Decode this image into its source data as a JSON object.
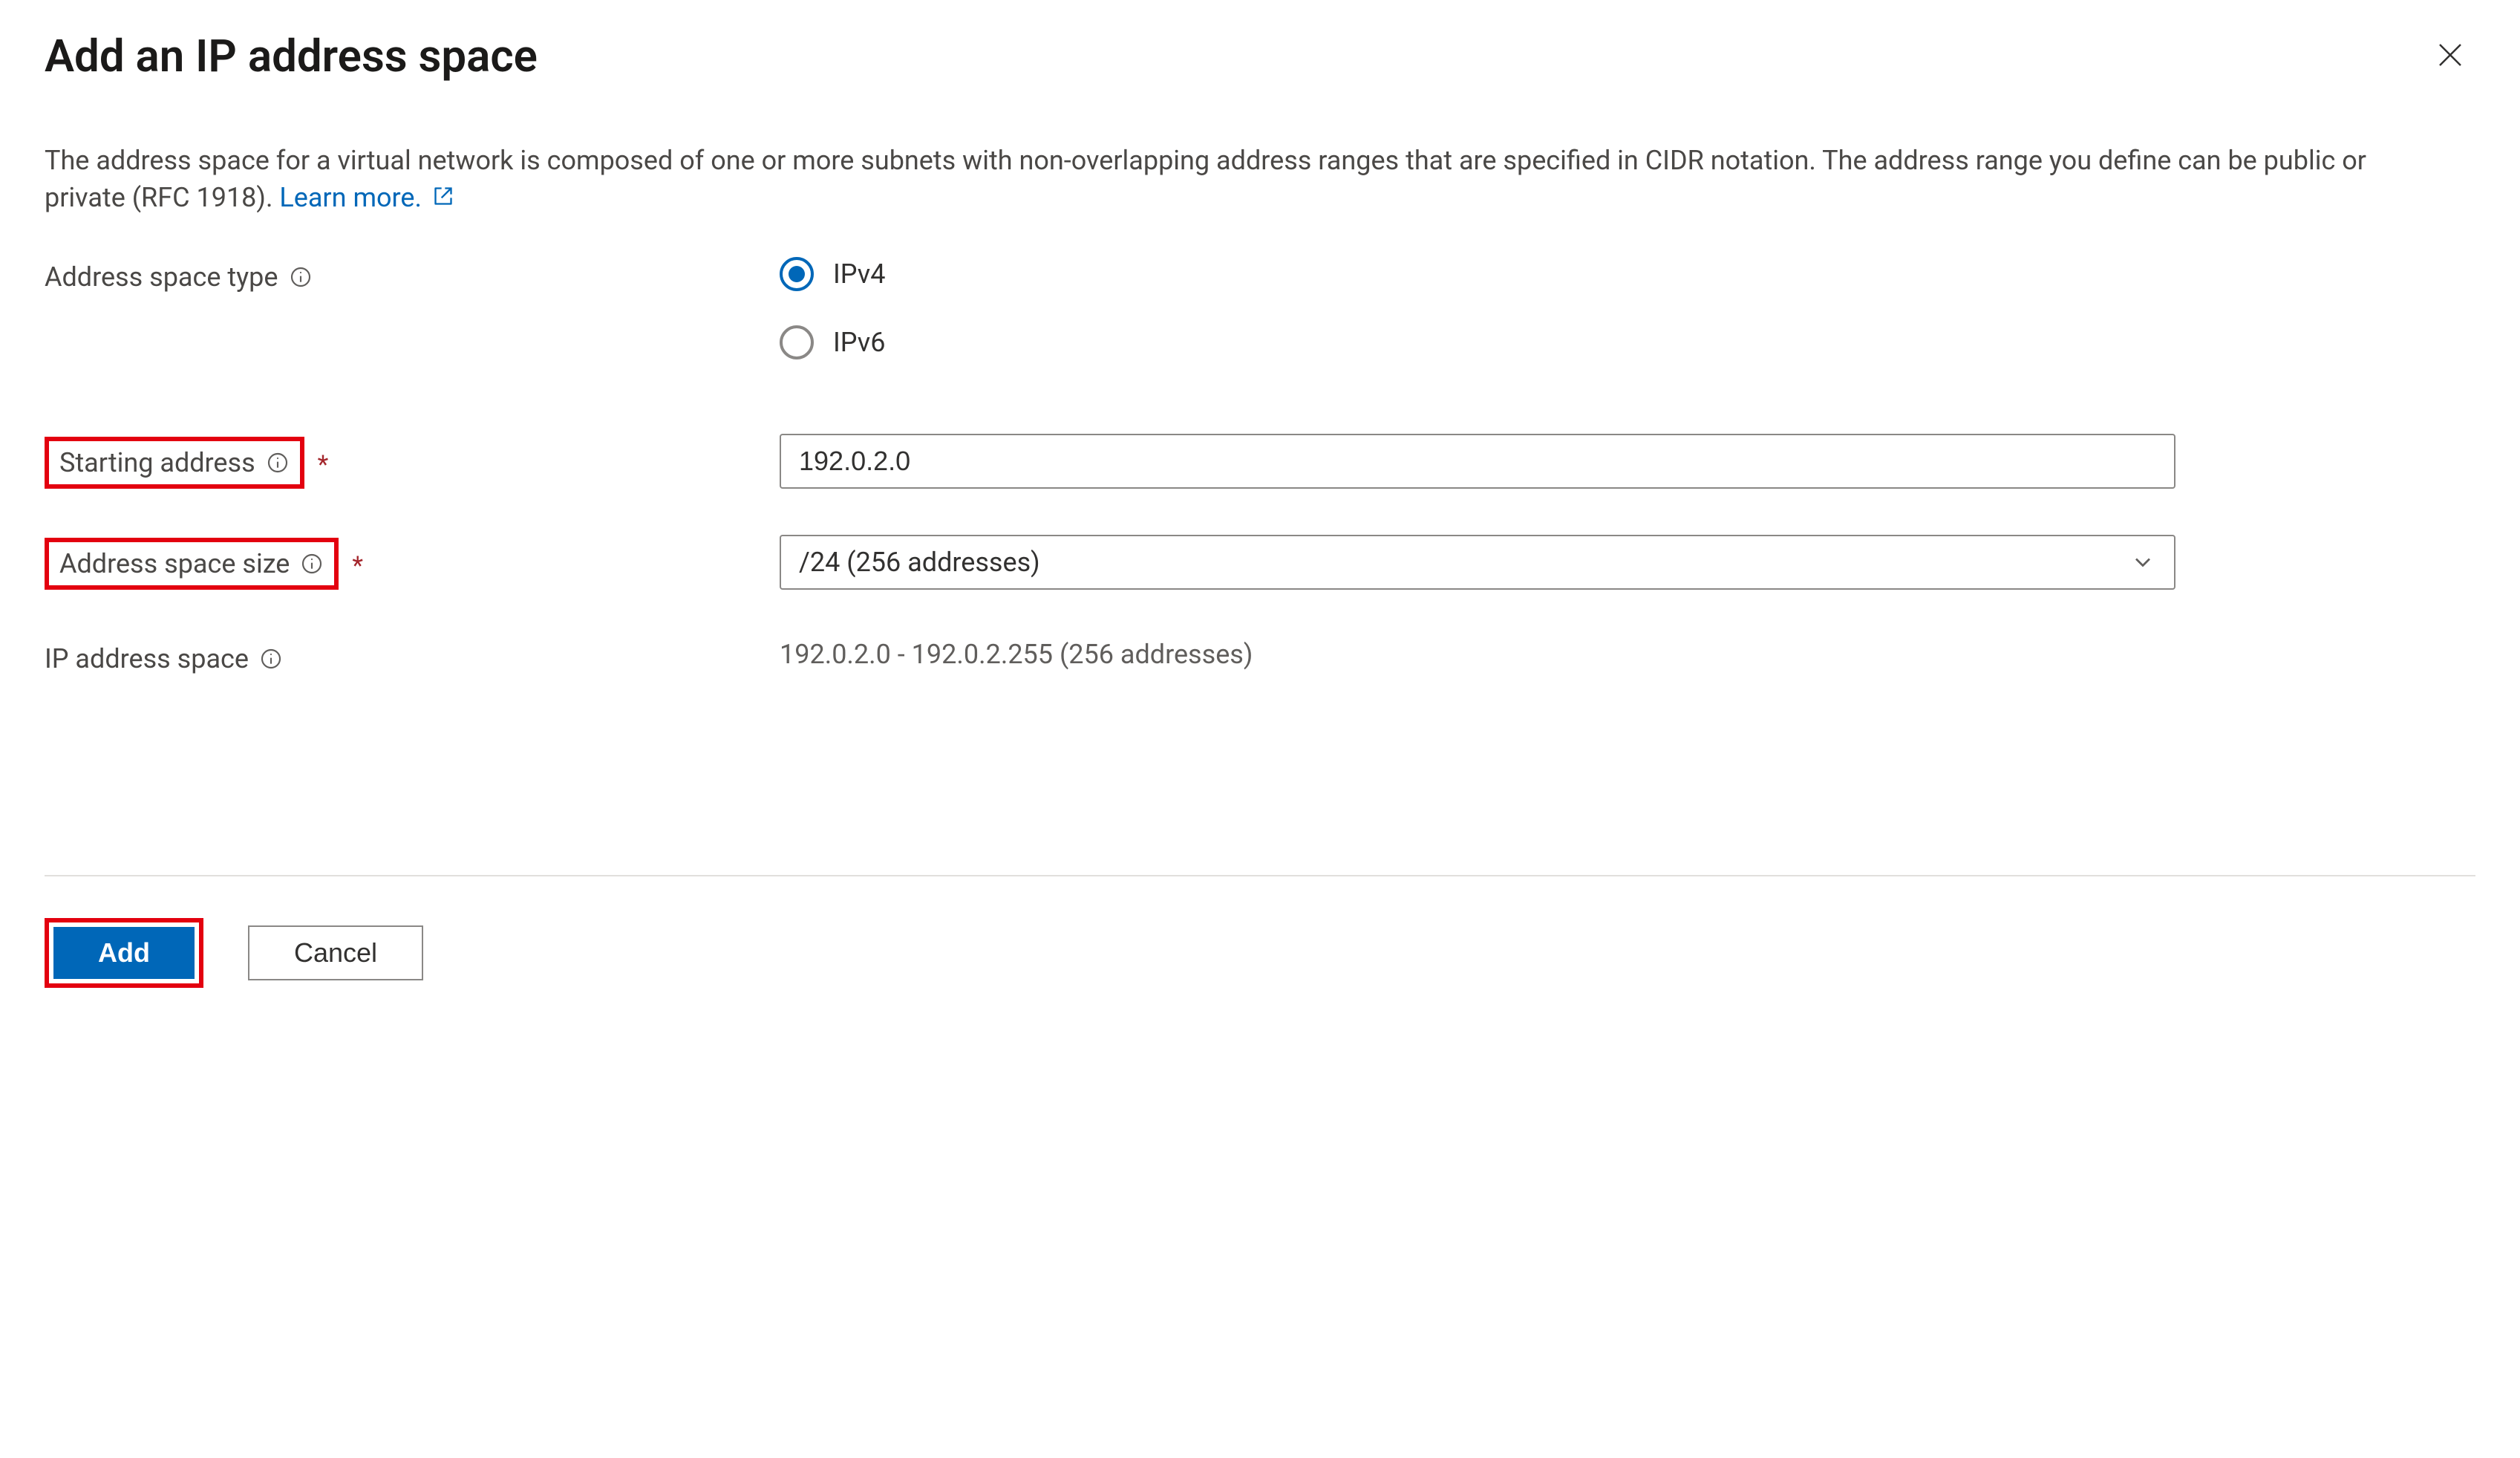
{
  "header": {
    "title": "Add an IP address space"
  },
  "description": {
    "text": "The address space for a virtual network is composed of one or more subnets with non-overlapping address ranges that are specified in CIDR notation. The address range you define can be public or private (RFC 1918). ",
    "learn_more": "Learn more."
  },
  "fields": {
    "address_space_type": {
      "label": "Address space type",
      "options": {
        "ipv4": "IPv4",
        "ipv6": "IPv6"
      },
      "selected": "ipv4"
    },
    "starting_address": {
      "label": "Starting address",
      "value": "192.0.2.0"
    },
    "address_space_size": {
      "label": "Address space size",
      "value": "/24 (256 addresses)"
    },
    "ip_address_space": {
      "label": "IP address space",
      "value": "192.0.2.0 - 192.0.2.255 (256 addresses)"
    }
  },
  "footer": {
    "add": "Add",
    "cancel": "Cancel"
  }
}
